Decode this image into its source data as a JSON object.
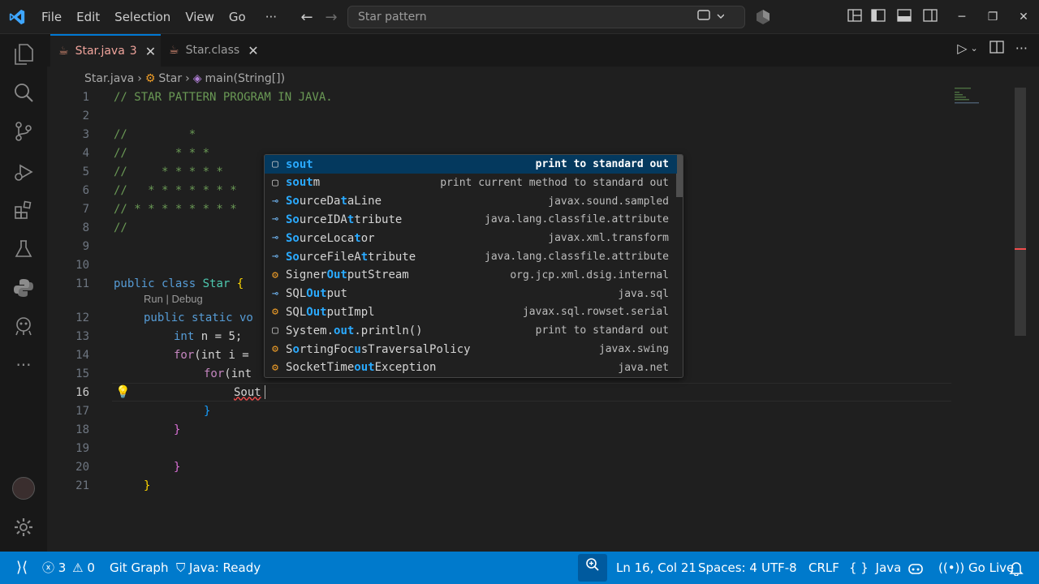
{
  "titlebar": {
    "menu": [
      "File",
      "Edit",
      "Selection",
      "View",
      "Go",
      "···"
    ],
    "search_text": "Star pattern",
    "window_buttons": [
      "─",
      "❐",
      "✕"
    ]
  },
  "tabs": [
    {
      "label": "Star.java",
      "problems": "3",
      "active": true
    },
    {
      "label": "Star.class",
      "active": false
    }
  ],
  "breadcrumb": {
    "file": "Star.java",
    "class": "Star",
    "method": "main(String[])"
  },
  "code": {
    "current_line": 16,
    "codelens": "Run | Debug",
    "lines": [
      {
        "n": "1"
      },
      {
        "n": "2"
      },
      {
        "n": "3"
      },
      {
        "n": "4"
      },
      {
        "n": "5"
      },
      {
        "n": "6"
      },
      {
        "n": "7"
      },
      {
        "n": "8"
      },
      {
        "n": "9"
      },
      {
        "n": "10"
      },
      {
        "n": "11"
      },
      {
        "n": "12"
      },
      {
        "n": "13"
      },
      {
        "n": "14"
      },
      {
        "n": "15"
      },
      {
        "n": "16"
      },
      {
        "n": "17"
      },
      {
        "n": "18"
      },
      {
        "n": "19"
      },
      {
        "n": "20"
      },
      {
        "n": "21"
      }
    ],
    "text": {
      "l1": "// STAR PATTERN PROGRAM IN JAVA.",
      "l3": "//         *",
      "l4": "//       * * *",
      "l5": "//     * * * * *",
      "l6": "//   * * * * * * *",
      "l7": "// * * * * * * * *",
      "l8": "//",
      "l11_kw": "public class",
      "l11_name": " Star ",
      "l11_brace": "{",
      "l12": "public static vo",
      "l13_kw": "int",
      "l13_rest": " n = 5;",
      "l14_kw": "for",
      "l14_rest": "(int i = ",
      "l15_kw": "for",
      "l15_rest": "(int ",
      "l16": "Sout",
      "l17": "}",
      "l18": "}",
      "l20": "}",
      "l21": "}"
    }
  },
  "suggestions": [
    {
      "pre": "",
      "hl": "sout",
      "post": "",
      "detail": "print to standard out",
      "icon": "snippet",
      "selected": true
    },
    {
      "pre": "",
      "hl": "sout",
      "post": "m",
      "detail": "print current method to standard out",
      "icon": "snippet"
    },
    {
      "pre": "",
      "hl": "So",
      "post": "urceDa",
      "hl2": "t",
      "post2": "aLine",
      "detail": "javax.sound.sampled",
      "icon": "interface"
    },
    {
      "pre": "",
      "hl": "So",
      "post": "urceIDA",
      "hl2": "t",
      "post2": "tribute",
      "detail": "java.lang.classfile.attribute",
      "icon": "interface"
    },
    {
      "pre": "",
      "hl": "So",
      "post": "urceLoca",
      "hl2": "t",
      "post2": "or",
      "detail": "javax.xml.transform",
      "icon": "interface"
    },
    {
      "pre": "",
      "hl": "So",
      "post": "urceFileA",
      "hl2": "t",
      "post2": "tribute",
      "detail": "java.lang.classfile.attribute",
      "icon": "interface"
    },
    {
      "pre": "Signer",
      "hl": "Out",
      "post": "putStream",
      "detail": "org.jcp.xml.dsig.internal",
      "icon": "class"
    },
    {
      "pre": "SQL",
      "hl": "Out",
      "post": "put",
      "detail": "java.sql",
      "icon": "interface"
    },
    {
      "pre": "SQL",
      "hl": "Out",
      "post": "putImpl",
      "detail": "javax.sql.rowset.serial",
      "icon": "class"
    },
    {
      "pre": "System.",
      "hl": "out",
      "post": ".println()",
      "detail": "print to standard out",
      "icon": "snippet"
    },
    {
      "pre": "S",
      "hl": "o",
      "post": "rtingFoc",
      "hl2": "u",
      "post2": "sTraversalPolicy",
      "detail": "javax.swing",
      "icon": "class"
    },
    {
      "pre": "SocketTime",
      "hl": "out",
      "post": "Exception",
      "detail": "java.net",
      "icon": "class"
    }
  ],
  "statusbar": {
    "problems_errors": "3",
    "problems_warnings": "0",
    "git_graph": "Git Graph",
    "java_status": "Java: Ready",
    "position": "Ln 16, Col 21",
    "spaces": "Spaces: 4",
    "encoding": "UTF-8",
    "eol": "CRLF",
    "language": "Java",
    "go_live": "Go Live"
  },
  "colors": {
    "accent": "#007acc",
    "editor_bg": "#1f1f1f",
    "comment": "#6a9955",
    "keyword": "#569cd6",
    "suggest_highlight": "#2aaaff",
    "selected_row": "#04395e"
  }
}
